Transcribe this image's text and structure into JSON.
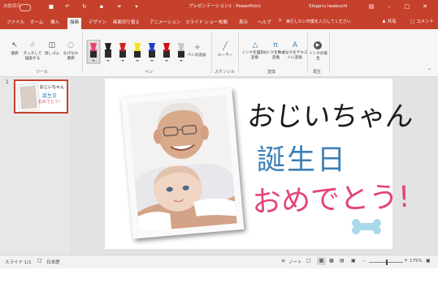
{
  "window": {
    "autosave": "自動保存",
    "title": "プレゼンテーション1 - PowerPoint",
    "user": "Shigeru Iwabuchi"
  },
  "tabs": [
    "ファイル",
    "ホーム",
    "挿入",
    "描画",
    "デザイン",
    "画面切り替え",
    "アニメーション",
    "スライド ショー",
    "校閲",
    "表示",
    "ヘルプ"
  ],
  "active_tab": "描画",
  "tell_me": "実行したい作業を入力してください",
  "share_label": "共有",
  "comment_label": "コメント",
  "ribbon": {
    "tools": {
      "select": "選択",
      "draw_touch": "タッチして描画する",
      "eraser": "消しゴム",
      "lasso": "なげなわ選択",
      "label": "ツール"
    },
    "pens": {
      "add_pen": "ペンの追加",
      "label": "ペン"
    },
    "stencils": {
      "ruler": "ルーラー",
      "label": "ステンシル"
    },
    "convert": {
      "ink_to_shape": "インクを図形に変換",
      "ink_to_math": "インクを数式に変換",
      "ink_to_text": "インクをテキストに変換",
      "label": "変換"
    },
    "replay": {
      "ink_replay": "インクの再生",
      "label": "再生"
    }
  },
  "pen_colors": [
    "#e8436b",
    "#222222",
    "#cc2222",
    "#f3e21a",
    "#1e40c0",
    "#d01010",
    "#c8c8c8"
  ],
  "slide_number": "1",
  "slide": {
    "line1": "おじいちゃん",
    "line2": "誕生日",
    "line3": "おめでとう!",
    "line1_color": "#1c1c1c",
    "line2_color": "#3d7fb6",
    "line3_color": "#e3447a",
    "bone_color": "#a9d9e8"
  },
  "status": {
    "slide_info": "スライド 1/1",
    "language": "日本語",
    "notes": "ノート",
    "zoom": "175%"
  }
}
